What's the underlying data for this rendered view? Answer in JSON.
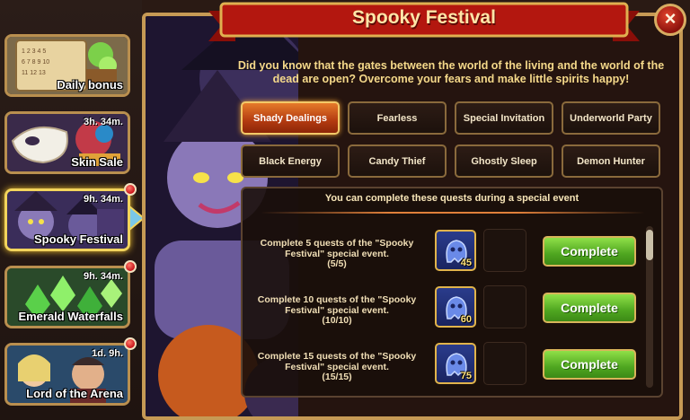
{
  "sidebar": {
    "events": [
      {
        "name": "Daily bonus",
        "timer": "",
        "notification": false
      },
      {
        "name": "Skin Sale",
        "timer": "3h. 34m.",
        "notification": false
      },
      {
        "name": "Spooky Festival",
        "timer": "9h. 34m.",
        "notification": true,
        "active": true
      },
      {
        "name": "Emerald Waterfalls",
        "timer": "9h. 34m.",
        "notification": true
      },
      {
        "name": "Lord of the Arena",
        "timer": "1d. 9h.",
        "notification": true
      }
    ]
  },
  "window": {
    "title": "Spooky Festival",
    "close_label": "×",
    "intro": "Did you know that the gates between the world of the living and the world of the dead are open? Overcome your fears and make little spirits happy!"
  },
  "tabs": [
    {
      "label": "Shady Dealings",
      "active": true
    },
    {
      "label": "Fearless",
      "active": false
    },
    {
      "label": "Special Invitation",
      "active": false
    },
    {
      "label": "Underworld Party",
      "active": false
    },
    {
      "label": "Black Energy",
      "active": false
    },
    {
      "label": "Candy Thief",
      "active": false
    },
    {
      "label": "Ghostly Sleep",
      "active": false
    },
    {
      "label": "Demon Hunter",
      "active": false
    }
  ],
  "quests": {
    "header": "You can complete these quests during a special event",
    "items": [
      {
        "description": "Complete 5 quests of the \"Spooky Festival\" special event.",
        "progress": "(5/5)",
        "reward_amount": "45",
        "button": "Complete"
      },
      {
        "description": "Complete 10 quests of the \"Spooky Festival\" special event.",
        "progress": "(10/10)",
        "reward_amount": "60",
        "button": "Complete"
      },
      {
        "description": "Complete 15 quests of the \"Spooky Festival\" special event.",
        "progress": "(15/15)",
        "reward_amount": "75",
        "button": "Complete"
      }
    ]
  },
  "colors": {
    "frame_gold": "#c69a55",
    "ribbon_red": "#b3170f",
    "title_gold": "#ffe6a8",
    "complete_green": "#4fa620",
    "active_tab_orange": "#e57a2a"
  },
  "icons": [
    "ghost-candy-icon",
    "close-icon",
    "notification-dot-icon",
    "active-event-arrow-icon"
  ]
}
